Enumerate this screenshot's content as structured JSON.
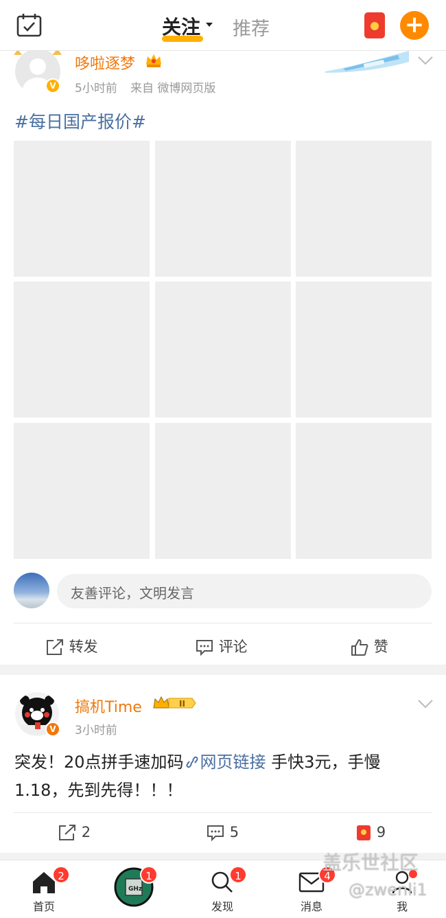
{
  "header": {
    "tab_follow": "关注",
    "tab_recommend": "推荐"
  },
  "post1": {
    "author": "哆啦逐梦",
    "time": "5小时前",
    "source": "来自 微博网页版",
    "topic": "#每日国产报价#",
    "comment_placeholder": "友善评论，文明发言",
    "actions": {
      "repost": "转发",
      "comment": "评论",
      "like": "赞"
    }
  },
  "post2": {
    "author": "搞机Time",
    "time": "3小时前",
    "text_before_link": "突发！20点拼手速加码",
    "link_text": "网页链接",
    "text_after_link": " 手快3元，手慢1.18，先到先得！！！",
    "repost_count": "2",
    "comment_count": "5",
    "like_count": "9"
  },
  "tabbar": {
    "home": {
      "label": "首页",
      "badge": "2"
    },
    "middle": {
      "badge": "1"
    },
    "discover": {
      "label": "发现",
      "badge": "1"
    },
    "messages": {
      "label": "消息",
      "badge": "4"
    },
    "me": {
      "label": "我"
    }
  },
  "watermark": {
    "site": "盖乐世社区",
    "user": "@zwenli1"
  },
  "colors": {
    "accent": "#ff8a00",
    "name": "#f0780a",
    "link": "#4a6fa1",
    "badge": "#ff3b30"
  }
}
